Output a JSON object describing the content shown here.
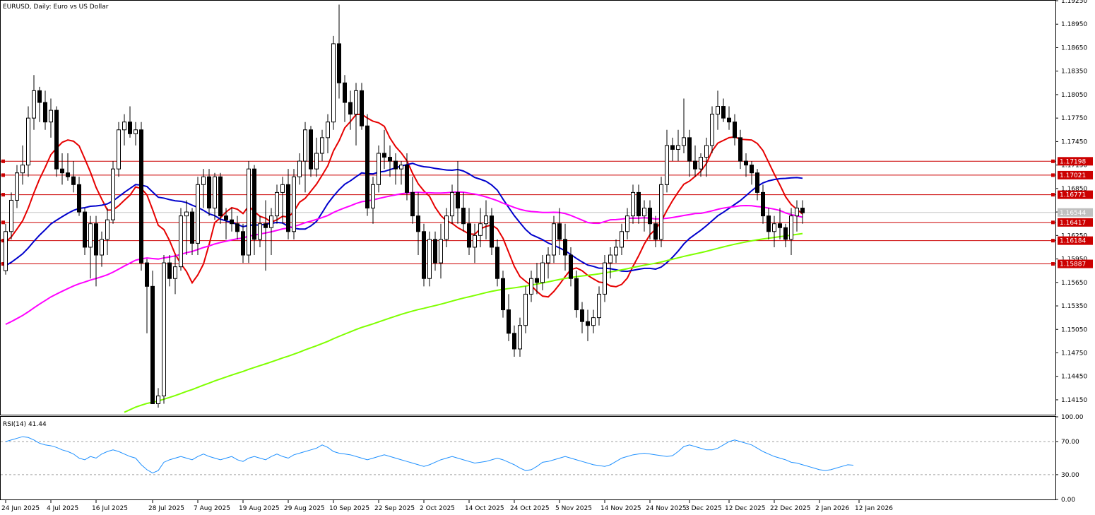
{
  "main_title": "EURUSD, Daily:  Euro vs US Dollar",
  "rsi_title": "RSI(14) 41.44",
  "colors": {
    "bull_fill": "#ffffff",
    "bear_fill": "#000000",
    "candle_outline": "#000000",
    "ma_fast": "#e60000",
    "ma_medium": "#0000cc",
    "ma_slow": "#ff00ff",
    "ma_long": "#7fff00",
    "level_line": "#cc0000",
    "level_tag_bg": "#cc0000",
    "current_price_tag": "#c0c0c0",
    "rsi_line": "#1e90ff",
    "rsi_level_line": "#a0a0a0",
    "grid_border": "#000000"
  },
  "chart_data": {
    "type": "candlestick",
    "symbol": "EURUSD",
    "timeframe": "Daily",
    "ylim": [
      1.1396,
      1.1925
    ],
    "price_ticks": [
      "1.19250",
      "1.18950",
      "1.18650",
      "1.18350",
      "1.18050",
      "1.17750",
      "1.17450",
      "1.17150",
      "1.16850",
      "1.16550",
      "1.16250",
      "1.15950",
      "1.15650",
      "1.15350",
      "1.15050",
      "1.14750",
      "1.14450",
      "1.14150"
    ],
    "date_ticks": [
      {
        "label": "24 Jun 2025",
        "i": 0
      },
      {
        "label": "4 Jul 2025",
        "i": 8
      },
      {
        "label": "16 Jul 2025",
        "i": 16
      },
      {
        "label": "28 Jul 2025",
        "i": 26
      },
      {
        "label": "7 Aug 2025",
        "i": 34
      },
      {
        "label": "19 Aug 2025",
        "i": 42
      },
      {
        "label": "29 Aug 2025",
        "i": 50
      },
      {
        "label": "10 Sep 2025",
        "i": 58
      },
      {
        "label": "22 Sep 2025",
        "i": 66
      },
      {
        "label": "2 Oct 2025",
        "i": 74
      },
      {
        "label": "14 Oct 2025",
        "i": 82
      },
      {
        "label": "24 Oct 2025",
        "i": 90
      },
      {
        "label": "5 Nov 2025",
        "i": 98
      },
      {
        "label": "14 Nov 2025",
        "i": 106
      },
      {
        "label": "24 Nov 2025",
        "i": 114
      },
      {
        "label": "3 Dec 2025",
        "i": 121
      },
      {
        "label": "12 Dec 2025",
        "i": 128
      },
      {
        "label": "22 Dec 2025",
        "i": 136
      },
      {
        "label": "2 Jan 2026",
        "i": 144
      },
      {
        "label": "12 Jan 2026",
        "i": 151
      }
    ],
    "levels": [
      {
        "value": 1.17198,
        "label": "1.17198"
      },
      {
        "value": 1.17021,
        "label": "1.17021"
      },
      {
        "value": 1.16771,
        "label": "1.16771"
      },
      {
        "value": 1.16417,
        "label": "1.16417"
      },
      {
        "value": 1.16184,
        "label": "1.16184"
      },
      {
        "value": 1.15887,
        "label": "1.15887"
      }
    ],
    "current_price": {
      "value": 1.16544,
      "label": "1.16544"
    },
    "candles": [
      [
        1.158,
        1.164,
        1.1575,
        1.163
      ],
      [
        1.163,
        1.168,
        1.162,
        1.167
      ],
      [
        1.167,
        1.1715,
        1.166,
        1.1705
      ],
      [
        1.1705,
        1.174,
        1.169,
        1.1715
      ],
      [
        1.1715,
        1.179,
        1.17,
        1.1775
      ],
      [
        1.1775,
        1.183,
        1.176,
        1.181
      ],
      [
        1.181,
        1.1815,
        1.177,
        1.1795
      ],
      [
        1.1795,
        1.181,
        1.176,
        1.177
      ],
      [
        1.177,
        1.18,
        1.175,
        1.1785
      ],
      [
        1.1785,
        1.179,
        1.17,
        1.171
      ],
      [
        1.171,
        1.173,
        1.169,
        1.1705
      ],
      [
        1.1705,
        1.173,
        1.1695,
        1.17
      ],
      [
        1.17,
        1.172,
        1.168,
        1.169
      ],
      [
        1.169,
        1.17,
        1.165,
        1.1655
      ],
      [
        1.1655,
        1.166,
        1.16,
        1.161
      ],
      [
        1.161,
        1.165,
        1.157,
        1.164
      ],
      [
        1.164,
        1.165,
        1.156,
        1.16
      ],
      [
        1.16,
        1.163,
        1.1585,
        1.162
      ],
      [
        1.162,
        1.166,
        1.16,
        1.1645
      ],
      [
        1.1645,
        1.172,
        1.164,
        1.171
      ],
      [
        1.171,
        1.177,
        1.17,
        1.176
      ],
      [
        1.176,
        1.178,
        1.174,
        1.177
      ],
      [
        1.177,
        1.179,
        1.175,
        1.1755
      ],
      [
        1.1755,
        1.177,
        1.174,
        1.176
      ],
      [
        1.176,
        1.177,
        1.158,
        1.159
      ],
      [
        1.159,
        1.1595,
        1.15,
        1.156
      ],
      [
        1.156,
        1.158,
        1.142,
        1.141
      ],
      [
        1.141,
        1.143,
        1.1405,
        1.142
      ],
      [
        1.142,
        1.16,
        1.141,
        1.159
      ],
      [
        1.159,
        1.16,
        1.156,
        1.157
      ],
      [
        1.157,
        1.16,
        1.155,
        1.1585
      ],
      [
        1.1585,
        1.166,
        1.158,
        1.165
      ],
      [
        1.165,
        1.167,
        1.16,
        1.1655
      ],
      [
        1.1655,
        1.166,
        1.16,
        1.1615
      ],
      [
        1.1615,
        1.17,
        1.16,
        1.169
      ],
      [
        1.169,
        1.171,
        1.166,
        1.17
      ],
      [
        1.17,
        1.171,
        1.165,
        1.166
      ],
      [
        1.166,
        1.1705,
        1.1645,
        1.17
      ],
      [
        1.17,
        1.1705,
        1.164,
        1.165
      ],
      [
        1.165,
        1.166,
        1.162,
        1.1645
      ],
      [
        1.1645,
        1.166,
        1.163,
        1.164
      ],
      [
        1.164,
        1.165,
        1.162,
        1.163
      ],
      [
        1.163,
        1.164,
        1.159,
        1.16
      ],
      [
        1.16,
        1.172,
        1.159,
        1.171
      ],
      [
        1.171,
        1.1715,
        1.16,
        1.162
      ],
      [
        1.162,
        1.165,
        1.161,
        1.164
      ],
      [
        1.164,
        1.167,
        1.158,
        1.1635
      ],
      [
        1.1635,
        1.166,
        1.16,
        1.165
      ],
      [
        1.165,
        1.169,
        1.164,
        1.168
      ],
      [
        1.168,
        1.17,
        1.164,
        1.169
      ],
      [
        1.169,
        1.171,
        1.162,
        1.163
      ],
      [
        1.163,
        1.171,
        1.162,
        1.17
      ],
      [
        1.17,
        1.173,
        1.169,
        1.172
      ],
      [
        1.172,
        1.177,
        1.168,
        1.176
      ],
      [
        1.176,
        1.1765,
        1.17,
        1.171
      ],
      [
        1.171,
        1.175,
        1.17,
        1.173
      ],
      [
        1.173,
        1.176,
        1.172,
        1.175
      ],
      [
        1.175,
        1.178,
        1.173,
        1.177
      ],
      [
        1.177,
        1.188,
        1.176,
        1.187
      ],
      [
        1.187,
        1.192,
        1.18,
        1.182
      ],
      [
        1.182,
        1.183,
        1.177,
        1.1795
      ],
      [
        1.1795,
        1.181,
        1.176,
        1.178
      ],
      [
        1.178,
        1.182,
        1.174,
        1.181
      ],
      [
        1.181,
        1.182,
        1.176,
        1.1765
      ],
      [
        1.1765,
        1.178,
        1.165,
        1.166
      ],
      [
        1.166,
        1.17,
        1.164,
        1.169
      ],
      [
        1.169,
        1.174,
        1.168,
        1.173
      ],
      [
        1.173,
        1.176,
        1.171,
        1.1725
      ],
      [
        1.1725,
        1.174,
        1.17,
        1.172
      ],
      [
        1.172,
        1.173,
        1.169,
        1.171
      ],
      [
        1.171,
        1.172,
        1.169,
        1.1715
      ],
      [
        1.1715,
        1.173,
        1.167,
        1.168
      ],
      [
        1.168,
        1.17,
        1.164,
        1.165
      ],
      [
        1.165,
        1.168,
        1.16,
        1.163
      ],
      [
        1.163,
        1.164,
        1.156,
        1.157
      ],
      [
        1.157,
        1.163,
        1.156,
        1.162
      ],
      [
        1.162,
        1.163,
        1.158,
        1.159
      ],
      [
        1.159,
        1.164,
        1.157,
        1.162
      ],
      [
        1.162,
        1.166,
        1.161,
        1.165
      ],
      [
        1.165,
        1.169,
        1.164,
        1.168
      ],
      [
        1.168,
        1.172,
        1.164,
        1.166
      ],
      [
        1.166,
        1.168,
        1.163,
        1.164
      ],
      [
        1.164,
        1.166,
        1.16,
        1.161
      ],
      [
        1.161,
        1.164,
        1.159,
        1.1625
      ],
      [
        1.1625,
        1.166,
        1.161,
        1.164
      ],
      [
        1.164,
        1.167,
        1.162,
        1.165
      ],
      [
        1.165,
        1.166,
        1.16,
        1.161
      ],
      [
        1.161,
        1.162,
        1.156,
        1.157
      ],
      [
        1.157,
        1.158,
        1.152,
        1.153
      ],
      [
        1.153,
        1.155,
        1.149,
        1.15
      ],
      [
        1.15,
        1.151,
        1.147,
        1.148
      ],
      [
        1.148,
        1.152,
        1.147,
        1.151
      ],
      [
        1.151,
        1.156,
        1.15,
        1.155
      ],
      [
        1.155,
        1.158,
        1.154,
        1.157
      ],
      [
        1.157,
        1.159,
        1.155,
        1.1565
      ],
      [
        1.1565,
        1.16,
        1.1555,
        1.159
      ],
      [
        1.159,
        1.161,
        1.157,
        1.16
      ],
      [
        1.16,
        1.165,
        1.159,
        1.164
      ],
      [
        1.164,
        1.166,
        1.16,
        1.162
      ],
      [
        1.162,
        1.164,
        1.158,
        1.16
      ],
      [
        1.16,
        1.161,
        1.156,
        1.157
      ],
      [
        1.157,
        1.158,
        1.152,
        1.153
      ],
      [
        1.153,
        1.154,
        1.15,
        1.1515
      ],
      [
        1.1515,
        1.153,
        1.149,
        1.151
      ],
      [
        1.151,
        1.153,
        1.15,
        1.152
      ],
      [
        1.152,
        1.156,
        1.151,
        1.155
      ],
      [
        1.155,
        1.16,
        1.154,
        1.159
      ],
      [
        1.159,
        1.161,
        1.157,
        1.16
      ],
      [
        1.16,
        1.162,
        1.159,
        1.161
      ],
      [
        1.161,
        1.164,
        1.16,
        1.163
      ],
      [
        1.163,
        1.166,
        1.162,
        1.165
      ],
      [
        1.165,
        1.169,
        1.164,
        1.168
      ],
      [
        1.168,
        1.169,
        1.164,
        1.165
      ],
      [
        1.165,
        1.167,
        1.163,
        1.166
      ],
      [
        1.166,
        1.167,
        1.162,
        1.164
      ],
      [
        1.164,
        1.165,
        1.161,
        1.162
      ],
      [
        1.162,
        1.17,
        1.161,
        1.169
      ],
      [
        1.169,
        1.176,
        1.168,
        1.174
      ],
      [
        1.174,
        1.175,
        1.172,
        1.1735
      ],
      [
        1.1735,
        1.176,
        1.172,
        1.174
      ],
      [
        1.174,
        1.18,
        1.173,
        1.175
      ],
      [
        1.175,
        1.176,
        1.17,
        1.172
      ],
      [
        1.172,
        1.174,
        1.17,
        1.171
      ],
      [
        1.171,
        1.173,
        1.17,
        1.1725
      ],
      [
        1.1725,
        1.175,
        1.17,
        1.174
      ],
      [
        1.174,
        1.179,
        1.173,
        1.178
      ],
      [
        1.178,
        1.181,
        1.176,
        1.179
      ],
      [
        1.179,
        1.18,
        1.177,
        1.1775
      ],
      [
        1.1775,
        1.179,
        1.176,
        1.177
      ],
      [
        1.177,
        1.178,
        1.174,
        1.175
      ],
      [
        1.175,
        1.176,
        1.171,
        1.172
      ],
      [
        1.172,
        1.173,
        1.17,
        1.1715
      ],
      [
        1.1715,
        1.172,
        1.169,
        1.1705
      ],
      [
        1.1705,
        1.171,
        1.167,
        1.168
      ],
      [
        1.168,
        1.169,
        1.164,
        1.165
      ],
      [
        1.165,
        1.166,
        1.162,
        1.163
      ],
      [
        1.163,
        1.165,
        1.161,
        1.164
      ],
      [
        1.164,
        1.166,
        1.162,
        1.1635
      ],
      [
        1.1635,
        1.164,
        1.161,
        1.162
      ],
      [
        1.162,
        1.166,
        1.16,
        1.165
      ],
      [
        1.165,
        1.167,
        1.163,
        1.166
      ],
      [
        1.166,
        1.167,
        1.164,
        1.1654
      ]
    ],
    "rsi": {
      "ylim": [
        0,
        100
      ],
      "ticks": [
        "100.00",
        "70.00",
        "30.00",
        "0.00"
      ],
      "levels": [
        70,
        30
      ],
      "values": [
        70,
        72,
        74,
        76,
        75,
        72,
        68,
        66,
        65,
        63,
        60,
        58,
        55,
        50,
        48,
        52,
        50,
        55,
        58,
        60,
        58,
        55,
        52,
        50,
        42,
        36,
        32,
        35,
        45,
        48,
        50,
        52,
        50,
        48,
        52,
        55,
        52,
        50,
        48,
        50,
        52,
        48,
        46,
        50,
        52,
        50,
        48,
        52,
        55,
        52,
        50,
        54,
        56,
        58,
        60,
        62,
        66,
        63,
        58,
        56,
        55,
        54,
        52,
        50,
        48,
        50,
        52,
        54,
        52,
        50,
        48,
        46,
        44,
        42,
        40,
        42,
        45,
        48,
        50,
        52,
        50,
        48,
        46,
        44,
        45,
        46,
        48,
        50,
        48,
        45,
        42,
        38,
        35,
        36,
        40,
        45,
        46,
        48,
        50,
        52,
        50,
        48,
        46,
        44,
        42,
        41,
        40,
        42,
        46,
        50,
        52,
        54,
        55,
        56,
        55,
        54,
        53,
        52,
        53,
        58,
        64,
        66,
        64,
        62,
        60,
        60,
        62,
        66,
        70,
        72,
        70,
        68,
        66,
        62,
        58,
        55,
        52,
        50,
        48,
        45,
        44,
        42,
        40,
        38,
        36,
        35,
        36,
        38,
        40,
        42,
        41.44
      ]
    }
  }
}
